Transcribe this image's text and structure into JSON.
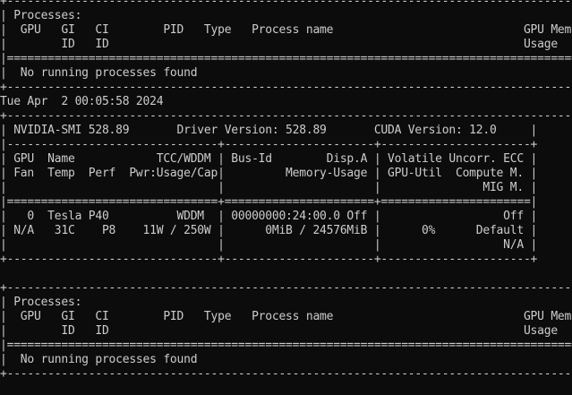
{
  "terminal": {
    "lines": [
      "+-----------------------------------------------------------------------------------------+",
      "| Processes:                                                                              |",
      "|  GPU   GI   CI        PID   Type   Process name                            GPU Memory |",
      "|        ID   ID                                                             Usage      |",
      "|=========================================================================================|",
      "|  No running processes found                                                             |",
      "+-----------------------------------------------------------------------------------------+",
      "Tue Apr  2 00:05:58 2024",
      "+-----------------------------------------------------------------------------------------+",
      "| NVIDIA-SMI 528.89       Driver Version: 528.89       CUDA Version: 12.0     |",
      "|-------------------------------+----------------------+----------------------+",
      "| GPU  Name            TCC/WDDM | Bus-Id        Disp.A | Volatile Uncorr. ECC |",
      "| Fan  Temp  Perf  Pwr:Usage/Cap|         Memory-Usage | GPU-Util  Compute M. |",
      "|                               |                      |               MIG M. |",
      "|===============================+======================+======================|",
      "|   0  Tesla P40          WDDM  | 00000000:24:00.0 Off |                  Off |",
      "| N/A   31C    P8    11W / 250W |      0MiB / 24576MiB |      0%      Default |",
      "|                               |                      |                  N/A |",
      "+-------------------------------+----------------------+----------------------+",
      "",
      "+-----------------------------------------------------------------------------------------+",
      "| Processes:                                                                              |",
      "|  GPU   GI   CI        PID   Type   Process name                            GPU Memory |",
      "|        ID   ID                                                             Usage      |",
      "|=========================================================================================|",
      "|  No running processes found                                                             |",
      "+-----------------------------------------------------------------------------------------+"
    ]
  }
}
